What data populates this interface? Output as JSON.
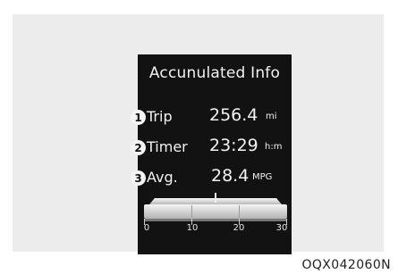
{
  "screen": {
    "title": "Accunulated Info",
    "rows": [
      {
        "number": "1",
        "label": "Trip",
        "value": "256.4",
        "unit": "mi"
      },
      {
        "number": "2",
        "label": "Timer",
        "value": "23:29",
        "unit": "h:m"
      },
      {
        "number": "3",
        "label": "Avg.",
        "value": "28.4",
        "unit": "MPG"
      }
    ],
    "gauge": {
      "scale_labels": [
        "0",
        "10",
        "20",
        "30"
      ],
      "min": 0,
      "max": 30,
      "pointer_value": 15
    }
  },
  "footer_code": "OQX042060N",
  "colors": {
    "screen_bg": "#121212",
    "panel_bg": "#ececec",
    "text": "#f2f2f2"
  }
}
